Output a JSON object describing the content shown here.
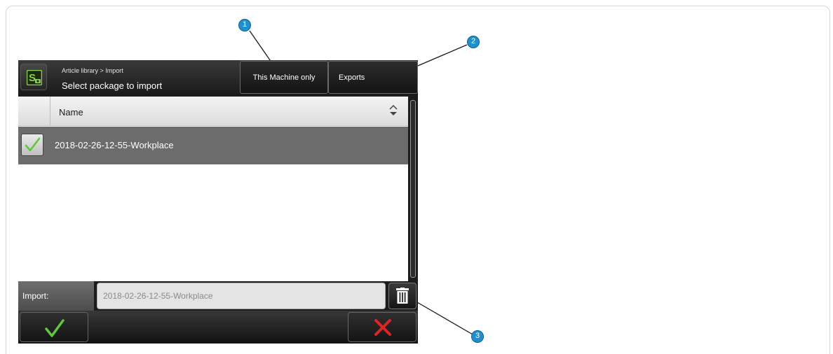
{
  "app": {
    "logo_icon": "app-logo-icon",
    "breadcrumb": "Article library > Import",
    "title": "Select package to import"
  },
  "header_buttons": {
    "machine_label": "This Machine only",
    "exports_label": "Exports"
  },
  "table": {
    "columns": [
      "Name"
    ],
    "sort_icon": "sort-up-down-icon",
    "rows": [
      {
        "checked": true,
        "name": "2018-02-26-12-55-Workplace"
      }
    ]
  },
  "import": {
    "label": "Import:",
    "value": "2018-02-26-12-55-Workplace",
    "delete_icon": "trash-icon"
  },
  "footer": {
    "ok_icon": "checkmark-icon",
    "cancel_icon": "close-x-icon"
  },
  "callouts": [
    "1",
    "2",
    "3"
  ],
  "colors": {
    "callout": "#1e8fcf",
    "accent_green": "#5cc83a",
    "cancel_red": "#e02424",
    "selected_row": "#6c6c6c"
  }
}
